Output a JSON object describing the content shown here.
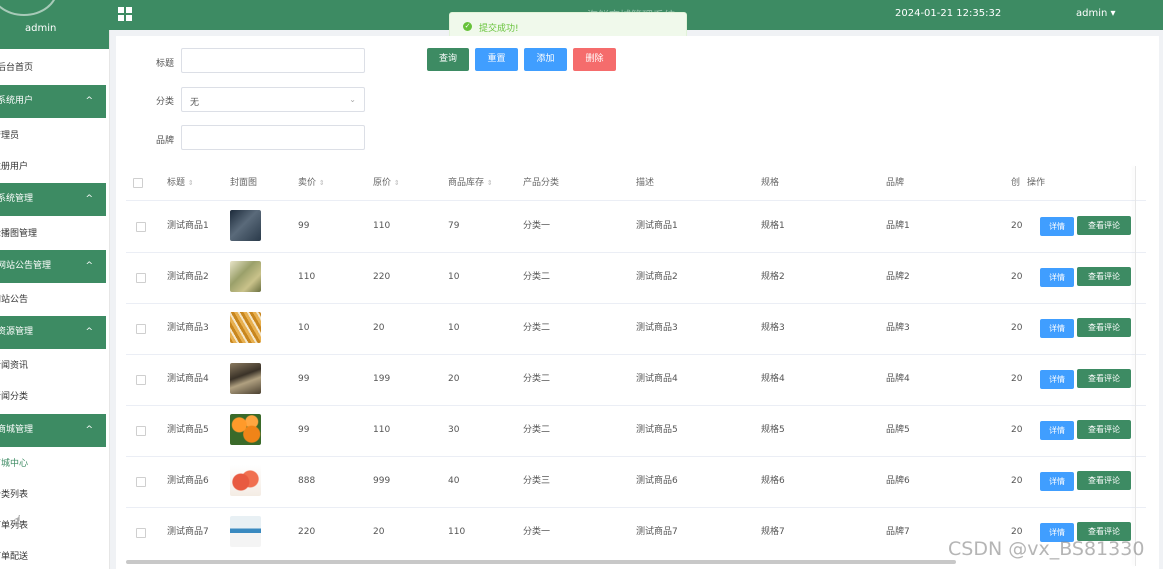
{
  "sidebar": {
    "username": "admin",
    "home": "后台首页",
    "groups": [
      {
        "label": "系统用户",
        "items": [
          "管理员",
          "注册用户"
        ]
      },
      {
        "label": "系统管理",
        "items": [
          "轮播图管理"
        ]
      },
      {
        "label": "网站公告管理",
        "items": [
          "网站公告"
        ]
      },
      {
        "label": "资源管理",
        "items": [
          "新闻资讯",
          "新闻分类"
        ]
      },
      {
        "label": "商城管理",
        "items": [
          "商城中心",
          "分类列表",
          "订单列表",
          "订单配送"
        ]
      }
    ]
  },
  "topbar": {
    "title": "海鲜商城管理系统",
    "datetime": "2024-01-21 12:35:32",
    "user": "admin ▾"
  },
  "toast": {
    "message": "提交成功!"
  },
  "filters": {
    "title_label": "标题",
    "title_value": "",
    "category_label": "分类",
    "category_value": "无",
    "brand_label": "品牌",
    "brand_value": ""
  },
  "buttons": {
    "search": "查询",
    "reset": "重置",
    "add": "添加",
    "delete": "删除"
  },
  "colors": {
    "primary": "#3d8b63",
    "blue": "#409eff",
    "delete": "#f56c6c",
    "toast_bg": "#f0f9eb",
    "toast_text": "#67c23a"
  },
  "table": {
    "columns": [
      "标题",
      "封面图",
      "卖价",
      "原价",
      "商品库存",
      "产品分类",
      "描述",
      "规格",
      "品牌",
      "创",
      "操作"
    ],
    "detail_label": "详情",
    "review_label": "查看评论",
    "rows": [
      {
        "title": "测试商品1",
        "price": "99",
        "orig": "110",
        "stock": "79",
        "cat": "分类一",
        "desc": "测试商品1",
        "spec": "规格1",
        "brand": "品牌1",
        "created": "20",
        "thumb": "seafood-dark"
      },
      {
        "title": "测试商品2",
        "price": "110",
        "orig": "220",
        "stock": "10",
        "cat": "分类二",
        "desc": "测试商品2",
        "spec": "规格2",
        "brand": "品牌2",
        "created": "20",
        "thumb": "snack-bag"
      },
      {
        "title": "测试商品3",
        "price": "10",
        "orig": "20",
        "stock": "10",
        "cat": "分类二",
        "desc": "测试商品3",
        "spec": "规格3",
        "brand": "品牌3",
        "created": "20",
        "thumb": "dried-shreds"
      },
      {
        "title": "测试商品4",
        "price": "99",
        "orig": "199",
        "stock": "20",
        "cat": "分类二",
        "desc": "测试商品4",
        "spec": "规格4",
        "brand": "品牌4",
        "created": "20",
        "thumb": "shrimp"
      },
      {
        "title": "测试商品5",
        "price": "99",
        "orig": "110",
        "stock": "30",
        "cat": "分类二",
        "desc": "测试商品5",
        "spec": "规格5",
        "brand": "品牌5",
        "created": "20",
        "thumb": "oranges"
      },
      {
        "title": "测试商品6",
        "price": "888",
        "orig": "999",
        "stock": "40",
        "cat": "分类三",
        "desc": "测试商品6",
        "spec": "规格6",
        "brand": "品牌6",
        "created": "20",
        "thumb": "peaches"
      },
      {
        "title": "测试商品7",
        "price": "220",
        "orig": "20",
        "stock": "110",
        "cat": "分类一",
        "desc": "测试商品7",
        "spec": "规格7",
        "brand": "品牌7",
        "created": "20",
        "thumb": "package"
      }
    ]
  },
  "watermark": "CSDN @vx_BS81330"
}
